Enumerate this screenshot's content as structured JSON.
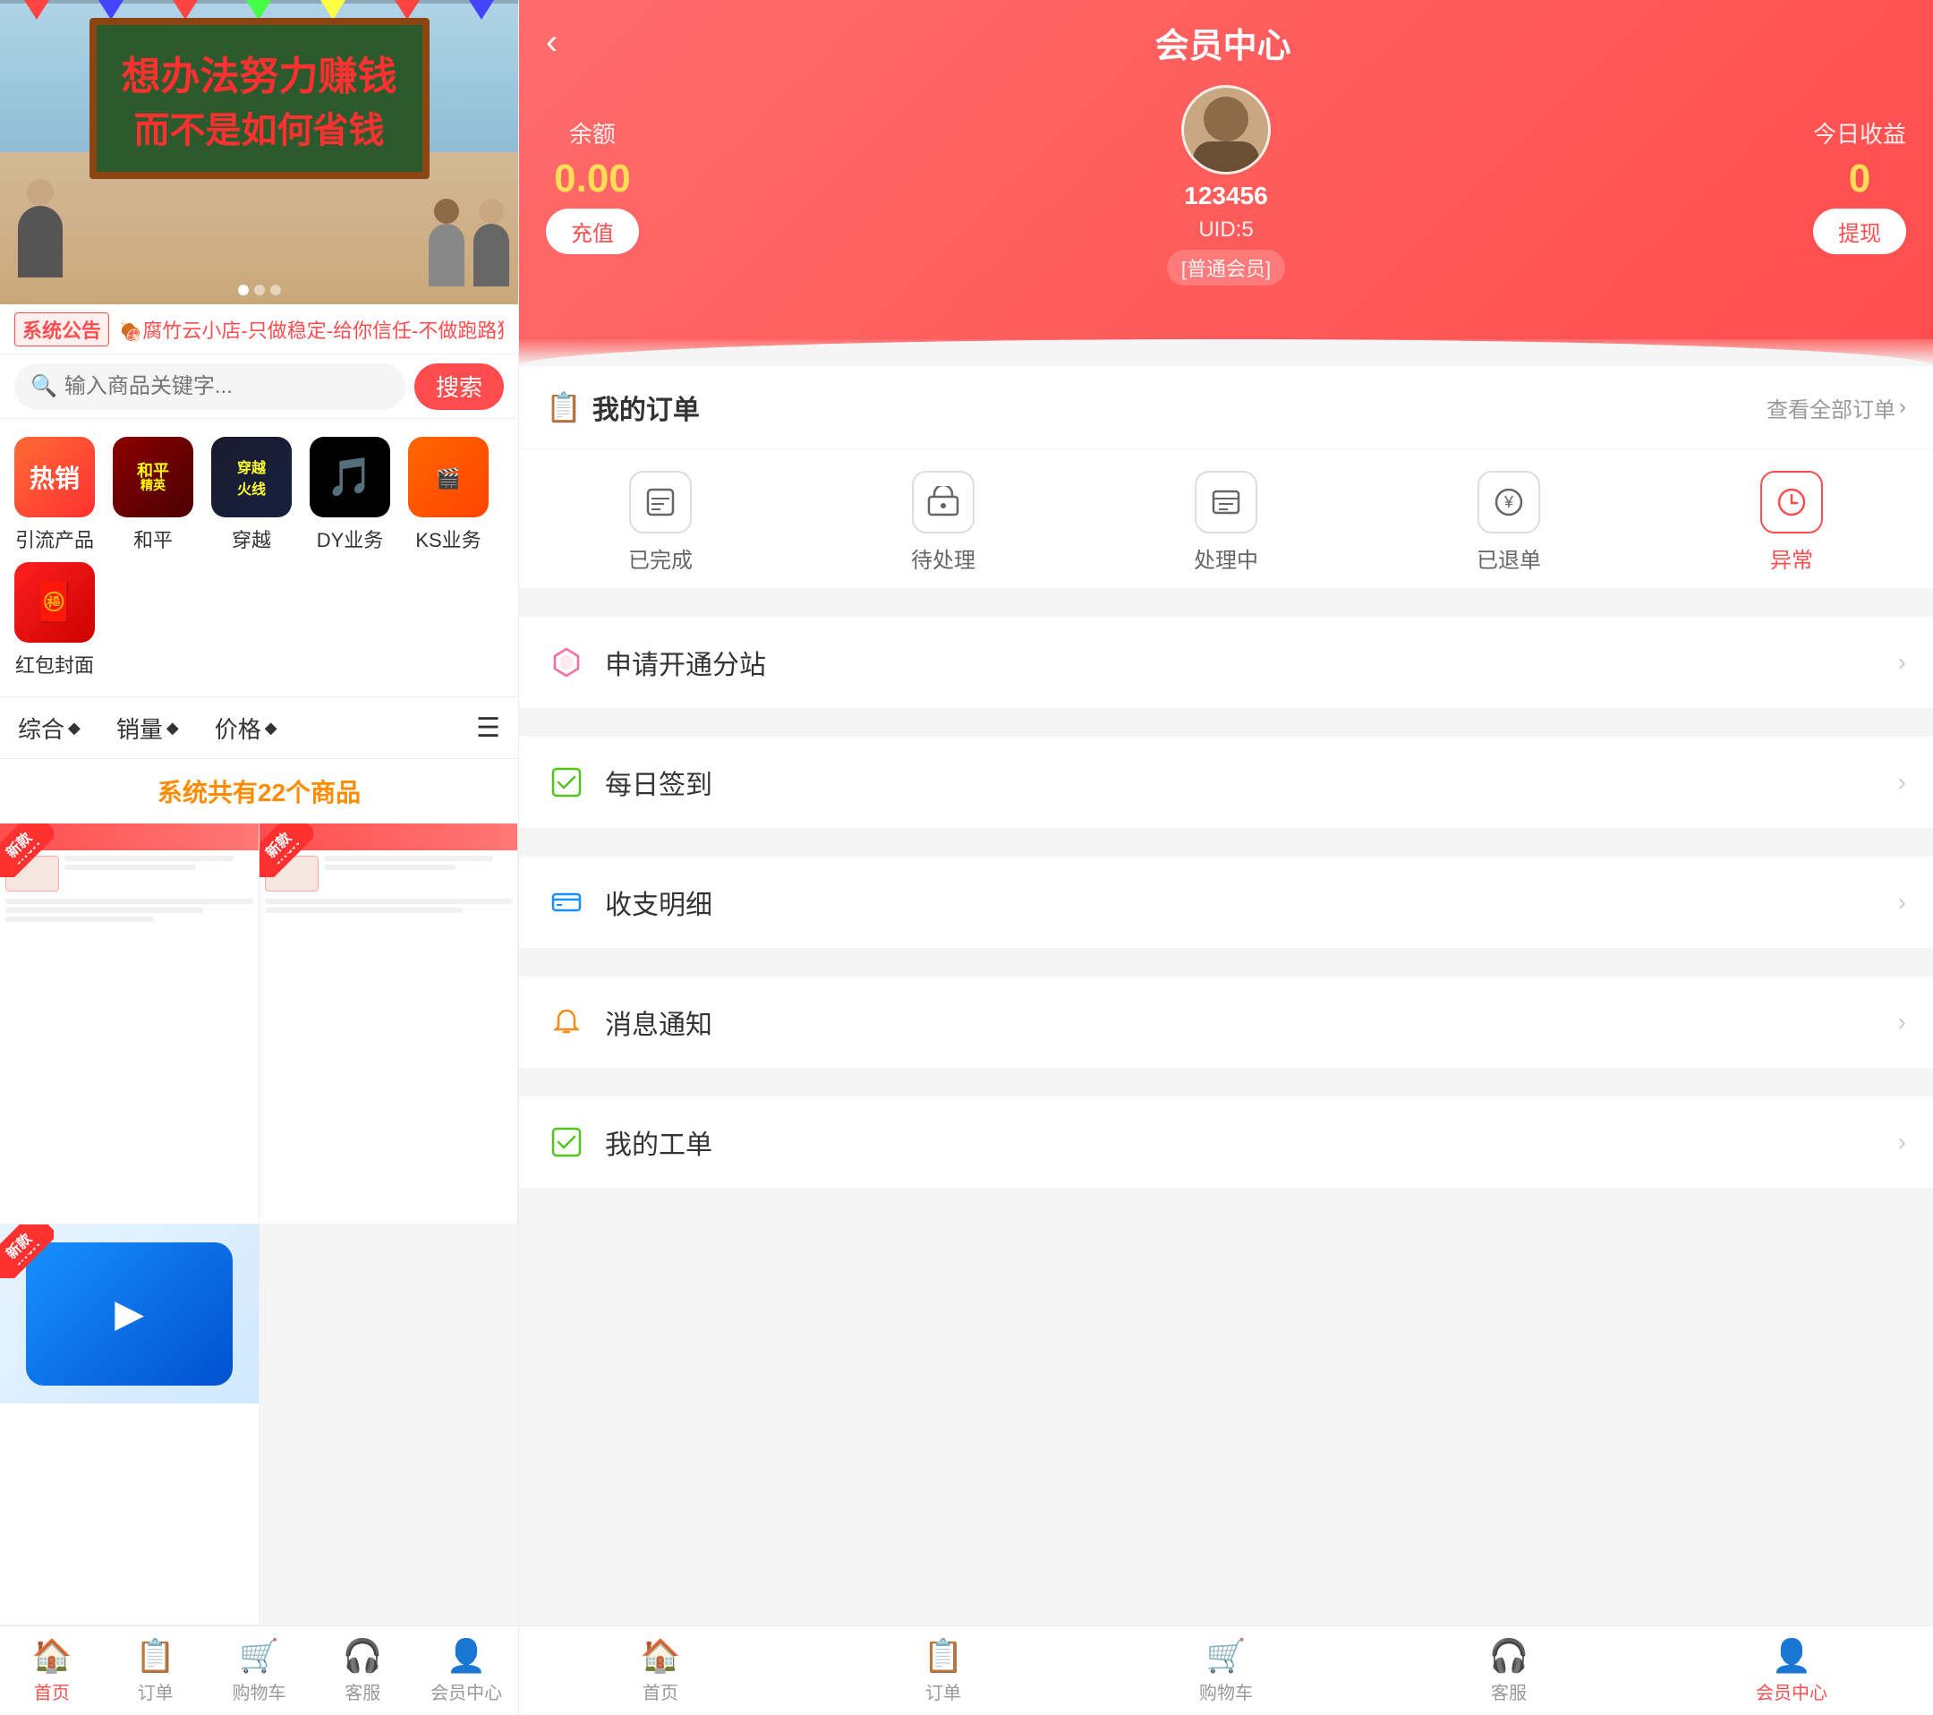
{
  "left": {
    "banner": {
      "text1": "想办法努力赚钱",
      "text2": "而不是如何省钱"
    },
    "notice": {
      "tag": "系统公告",
      "text": "🍖腐竹云小店-只做稳定-给你信任-不做跑路狗-售后稳定"
    },
    "search": {
      "placeholder": "输入商品关键字...",
      "button": "搜索"
    },
    "categories": [
      {
        "id": "hot",
        "label": "引流产品",
        "icon": "热销",
        "type": "hot"
      },
      {
        "id": "peace",
        "label": "和平",
        "icon": "和平",
        "type": "peace"
      },
      {
        "id": "cross",
        "label": "穿越",
        "icon": "穿越",
        "type": "cross"
      },
      {
        "id": "tiktok",
        "label": "DY业务",
        "icon": "🎵",
        "type": "tiktok"
      },
      {
        "id": "ks",
        "label": "KS业务",
        "icon": "KS",
        "type": "ks"
      },
      {
        "id": "red",
        "label": "红包封面",
        "icon": "🧧",
        "type": "red"
      }
    ],
    "sort": {
      "items": [
        "综合",
        "销量",
        "价格"
      ],
      "diamond": "◆"
    },
    "product_count": {
      "label": "系统共有22个商品"
    },
    "products": [
      {
        "id": 1,
        "badge": "新款"
      },
      {
        "id": 2,
        "badge": "新款"
      },
      {
        "id": 3,
        "badge": "新款"
      }
    ],
    "bottom_nav": [
      {
        "id": "home",
        "label": "首页",
        "icon": "🏠",
        "active": true
      },
      {
        "id": "order",
        "label": "订单",
        "icon": "📋",
        "active": false
      },
      {
        "id": "cart",
        "label": "购物车",
        "icon": "🛒",
        "active": false
      },
      {
        "id": "service",
        "label": "客服",
        "icon": "🎧",
        "active": false
      },
      {
        "id": "member",
        "label": "会员中心",
        "icon": "👤",
        "active": false
      }
    ]
  },
  "right": {
    "header": {
      "title": "会员中心",
      "back_icon": "‹",
      "balance": {
        "label": "余额",
        "amount": "0.00",
        "button": "充值"
      },
      "user": {
        "name": "123456",
        "uid": "UID:5",
        "level": "[普通会员]"
      },
      "today_income": {
        "label": "今日收益",
        "amount": "0",
        "button": "提现"
      }
    },
    "orders": {
      "title": "我的订单",
      "title_icon": "📋",
      "more_label": "查看全部订单",
      "more_arrow": ">",
      "status_items": [
        {
          "id": "done",
          "label": "已完成",
          "icon": "💳"
        },
        {
          "id": "pending",
          "label": "待处理",
          "icon": "🚚"
        },
        {
          "id": "processing",
          "label": "处理中",
          "icon": "📦"
        },
        {
          "id": "refunded",
          "label": "已退单",
          "icon": "¥"
        },
        {
          "id": "abnormal",
          "label": "异常",
          "icon": "🕐",
          "active": true
        }
      ]
    },
    "menu_items": [
      {
        "id": "subsite",
        "label": "申请开通分站",
        "icon": "💎",
        "type": "diamond"
      },
      {
        "id": "signin",
        "label": "每日签到",
        "icon": "✅",
        "type": "check"
      },
      {
        "id": "finance",
        "label": "收支明细",
        "icon": "💳",
        "type": "card"
      },
      {
        "id": "notify",
        "label": "消息通知",
        "icon": "🔔",
        "type": "bell"
      },
      {
        "id": "workorder",
        "label": "我的工单",
        "icon": "✅",
        "type": "workorder"
      }
    ],
    "bottom_nav": [
      {
        "id": "home",
        "label": "首页",
        "icon": "🏠",
        "active": false
      },
      {
        "id": "order",
        "label": "订单",
        "icon": "📋",
        "active": false
      },
      {
        "id": "cart",
        "label": "购物车",
        "icon": "🛒",
        "active": false
      },
      {
        "id": "service",
        "label": "客服",
        "icon": "🎧",
        "active": false
      },
      {
        "id": "member",
        "label": "会员中心",
        "icon": "👤",
        "active": true
      }
    ]
  }
}
